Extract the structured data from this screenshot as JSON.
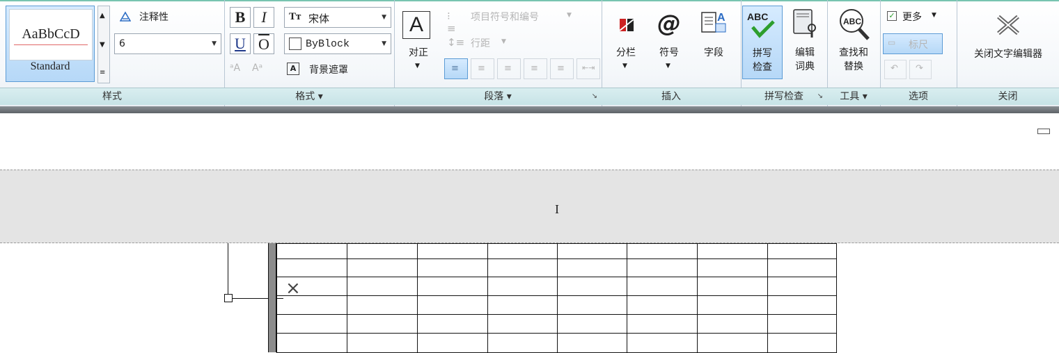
{
  "ribbon": {
    "styles_panel": {
      "title": "样式",
      "style_preview": "AaBbCcD",
      "style_name": "Standard",
      "annotative_label": "注释性",
      "text_height": "6"
    },
    "format_panel": {
      "title": "格式",
      "bold": "B",
      "italic": "I",
      "underline": "U",
      "overline": "O",
      "font_name": "宋体",
      "color_name": "ByBlock",
      "background_mask": "背景遮罩"
    },
    "paragraph_panel": {
      "title": "段落",
      "justify_label": "对正",
      "bullets_label": "项目符号和编号",
      "line_spacing_label": "行距"
    },
    "insert_panel": {
      "title": "插入",
      "columns_label": "分栏",
      "symbol_label": "符号",
      "field_label": "字段"
    },
    "spell_panel": {
      "title": "拼写检查",
      "spell_check_line1": "拼写",
      "spell_check_line2": "检查",
      "edit_dict_line1": "编辑",
      "edit_dict_line2": "词典"
    },
    "tools_panel": {
      "title": "工具",
      "find_replace_line1": "查找和",
      "find_replace_line2": "替换"
    },
    "options_panel": {
      "title": "选项",
      "more_label": "更多",
      "ruler_label": "标尺"
    },
    "close_panel": {
      "title": "关闭",
      "close_editor_label": "关闭文字编辑器"
    }
  },
  "colors": {
    "accent_teal": "#78c4b0",
    "active_blue": "#5b9bd5",
    "spell_check_green": "#2e9e2e",
    "field_icon_blue": "#2b6cc4"
  },
  "icons": {
    "annotative": "annotative-triangle-icon",
    "columns": "columns-icon",
    "symbol": "at-sign-icon",
    "field": "field-document-icon",
    "spell_check": "abc-check-icon",
    "edit_dictionary": "book-wrench-icon",
    "find_replace": "abc-magnifier-icon",
    "close": "close-x-icon"
  }
}
